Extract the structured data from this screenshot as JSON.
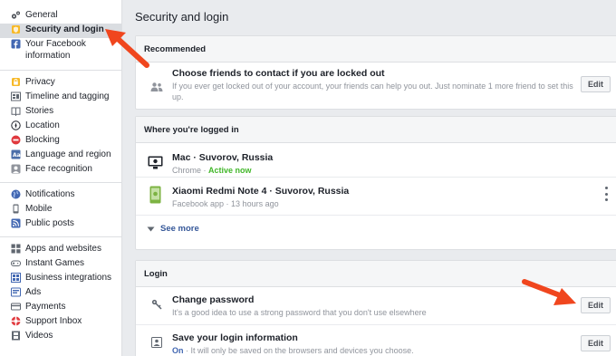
{
  "sidebar": {
    "groups": [
      [
        {
          "label": "General",
          "icon": "gears-icon"
        },
        {
          "label": "Security and login",
          "icon": "shield-icon",
          "selected": true
        },
        {
          "label": "Your Facebook information",
          "icon": "facebook-icon"
        }
      ],
      [
        {
          "label": "Privacy",
          "icon": "lock-icon"
        },
        {
          "label": "Timeline and tagging",
          "icon": "timeline-icon"
        },
        {
          "label": "Stories",
          "icon": "book-icon"
        },
        {
          "label": "Location",
          "icon": "compass-icon"
        },
        {
          "label": "Blocking",
          "icon": "block-icon"
        },
        {
          "label": "Language and region",
          "icon": "language-icon"
        },
        {
          "label": "Face recognition",
          "icon": "face-icon"
        }
      ],
      [
        {
          "label": "Notifications",
          "icon": "globe-icon"
        },
        {
          "label": "Mobile",
          "icon": "mobile-icon"
        },
        {
          "label": "Public posts",
          "icon": "rss-icon"
        }
      ],
      [
        {
          "label": "Apps and websites",
          "icon": "apps-icon"
        },
        {
          "label": "Instant Games",
          "icon": "gamepad-icon"
        },
        {
          "label": "Business integrations",
          "icon": "briefcase-icon"
        },
        {
          "label": "Ads",
          "icon": "ads-icon"
        },
        {
          "label": "Payments",
          "icon": "card-icon"
        },
        {
          "label": "Support Inbox",
          "icon": "support-icon"
        },
        {
          "label": "Videos",
          "icon": "film-icon"
        }
      ]
    ]
  },
  "main": {
    "title": "Security and login",
    "recommended": {
      "header": "Recommended",
      "title": "Choose friends to contact if you are locked out",
      "description": "If you ever get locked out of your account, your friends can help you out. Just nominate 1 more friend to set this up.",
      "edit_label": "Edit"
    },
    "logged_in": {
      "header": "Where you're logged in",
      "sessions": [
        {
          "device": "Mac · Suvorov, Russia",
          "app": "Chrome",
          "status": "Active now"
        },
        {
          "device": "Xiaomi Redmi Note 4 · Suvorov, Russia",
          "app": "Facebook app",
          "status": "13 hours ago"
        }
      ],
      "see_more": "See more"
    },
    "login": {
      "header": "Login",
      "change_password": {
        "title": "Change password",
        "description": "It's a good idea to use a strong password that you don't use elsewhere",
        "edit_label": "Edit"
      },
      "save_login": {
        "title": "Save your login information",
        "status": "On",
        "description": " · It will only be saved on the browsers and devices you choose.",
        "edit_label": "Edit"
      }
    }
  },
  "colors": {
    "accent_link": "#365899",
    "active_green": "#42b72a",
    "annotation_arrow": "#f0461e",
    "selected_bg": "#dadde1"
  }
}
